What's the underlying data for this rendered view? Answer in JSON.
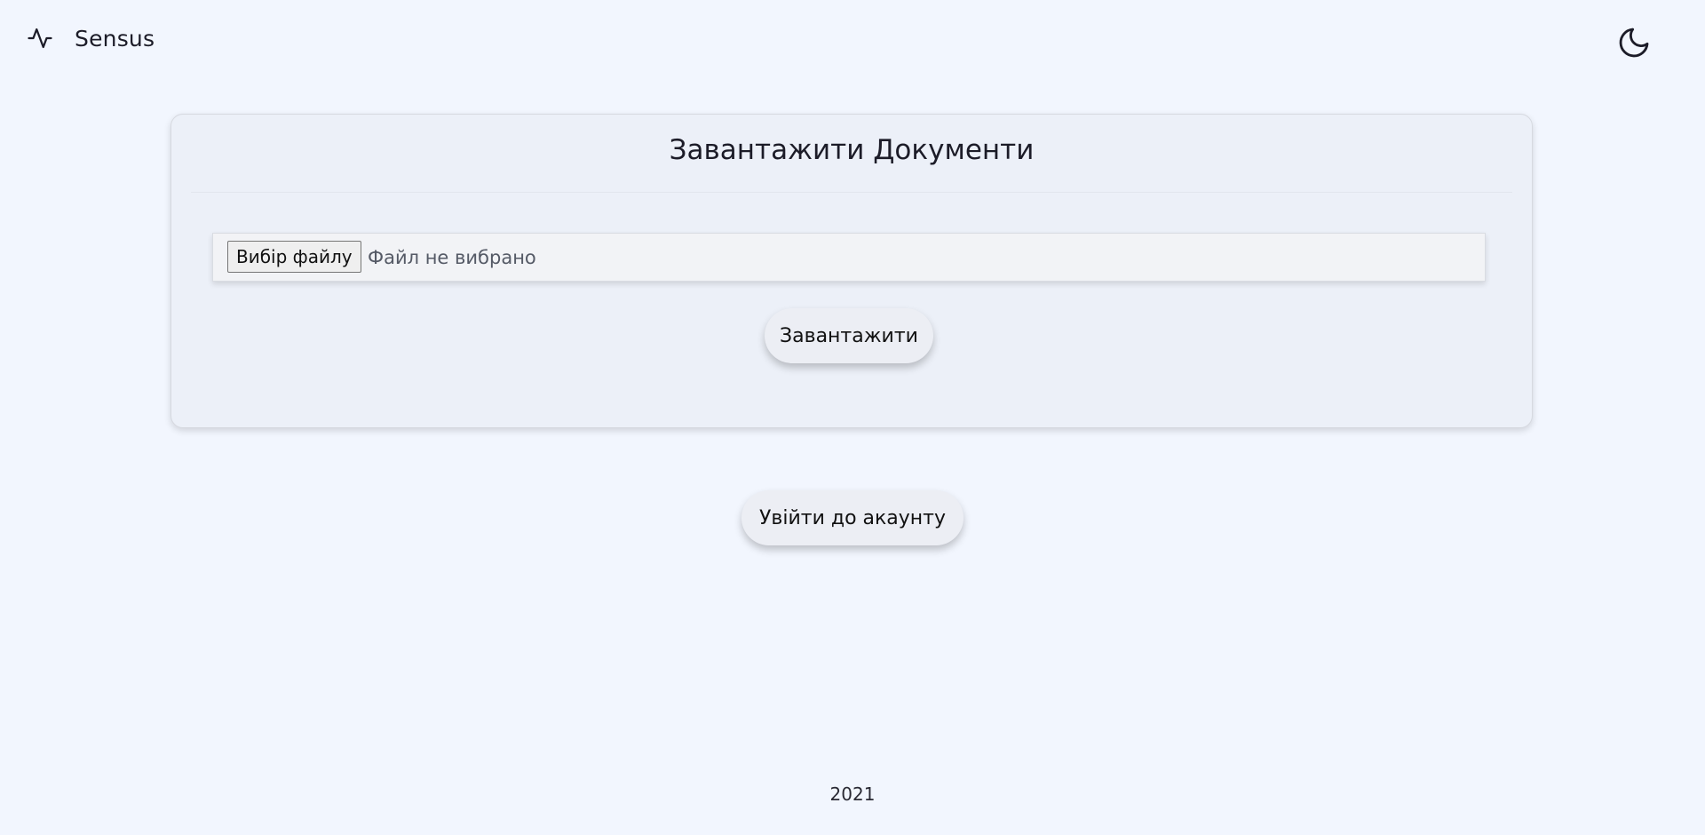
{
  "header": {
    "brand_name": "Sensus",
    "brand_icon": "activity-icon",
    "theme_toggle_icon": "moon-icon"
  },
  "upload_card": {
    "title": "Завантажити Документи",
    "file_input": {
      "button_label": "Вибір файлу",
      "status_text": "Файл не вибрано"
    },
    "upload_button_label": "Завантажити"
  },
  "login_button_label": "Увійти до акаунту",
  "footer": {
    "year": "2021"
  },
  "colors": {
    "background": "#f2f6fe",
    "card_background": "#ecf0f8",
    "text": "#1c1c28"
  }
}
